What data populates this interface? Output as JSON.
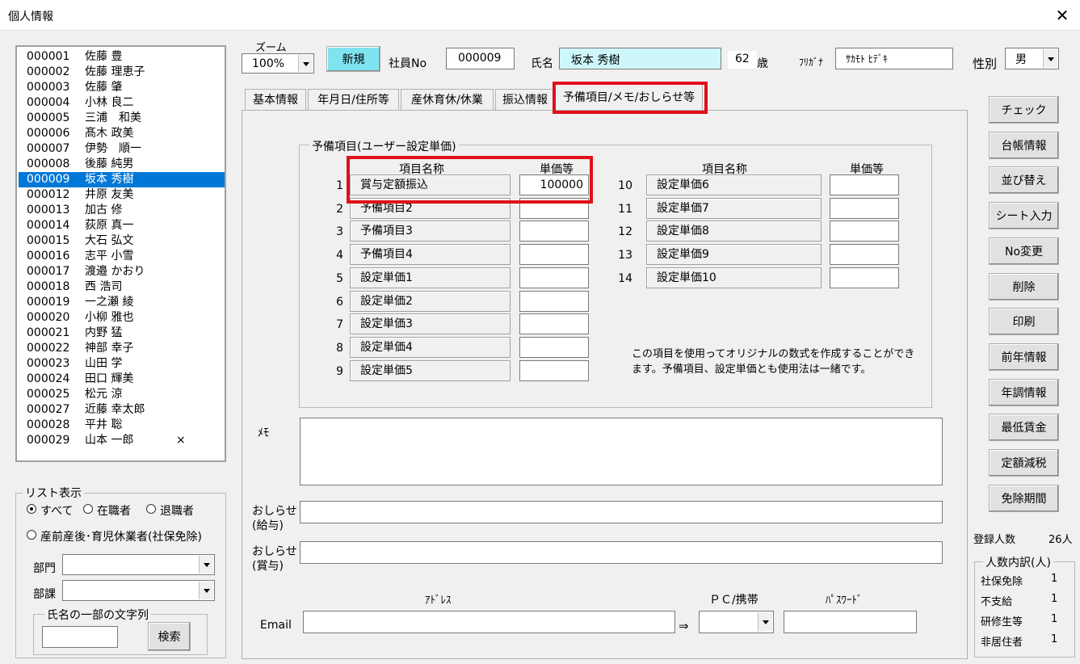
{
  "window": {
    "title": "個人情報",
    "close": "✕"
  },
  "list": {
    "items": [
      {
        "no": "000001",
        "name": "佐藤 豊",
        "mark": ""
      },
      {
        "no": "000002",
        "name": "佐藤 理恵子",
        "mark": ""
      },
      {
        "no": "000003",
        "name": "佐藤 肇",
        "mark": ""
      },
      {
        "no": "000004",
        "name": "小林 良二",
        "mark": ""
      },
      {
        "no": "000005",
        "name": "三浦　和美",
        "mark": ""
      },
      {
        "no": "000006",
        "name": "髙木 政美",
        "mark": ""
      },
      {
        "no": "000007",
        "name": "伊勢　順一",
        "mark": ""
      },
      {
        "no": "000008",
        "name": "後藤 純男",
        "mark": ""
      },
      {
        "no": "000009",
        "name": "坂本 秀樹",
        "mark": ""
      },
      {
        "no": "000012",
        "name": "井原 友美",
        "mark": ""
      },
      {
        "no": "000013",
        "name": "加古 修",
        "mark": ""
      },
      {
        "no": "000014",
        "name": "荻原 真一",
        "mark": ""
      },
      {
        "no": "000015",
        "name": "大石 弘文",
        "mark": ""
      },
      {
        "no": "000016",
        "name": "志平 小雪",
        "mark": ""
      },
      {
        "no": "000017",
        "name": "渡邉 かおり",
        "mark": ""
      },
      {
        "no": "000018",
        "name": "西 浩司",
        "mark": ""
      },
      {
        "no": "000019",
        "name": "一之瀬 綾",
        "mark": ""
      },
      {
        "no": "000020",
        "name": "小柳 雅也",
        "mark": ""
      },
      {
        "no": "000021",
        "name": "内野 猛",
        "mark": ""
      },
      {
        "no": "000022",
        "name": "神部 幸子",
        "mark": ""
      },
      {
        "no": "000023",
        "name": "山田 学",
        "mark": ""
      },
      {
        "no": "000024",
        "name": "田口 輝美",
        "mark": ""
      },
      {
        "no": "000025",
        "name": "松元 涼",
        "mark": ""
      },
      {
        "no": "000027",
        "name": "近藤 幸太郎",
        "mark": ""
      },
      {
        "no": "000028",
        "name": "平井 聡",
        "mark": ""
      },
      {
        "no": "000029",
        "name": "山本 一郎",
        "mark": "×"
      }
    ],
    "selected_index": 8
  },
  "list_display": {
    "group_label": "リスト表示",
    "opt_all": "すべて",
    "opt_employed": "在職者",
    "opt_retired": "退職者",
    "opt_leave": "産前産後･育児休業者(社保免除)",
    "dept_label": "部門",
    "section_label": "部課",
    "name_search_group": "氏名の一部の文字列",
    "search_button": "検索"
  },
  "header": {
    "zoom_label": "ズーム",
    "zoom_value": "100%",
    "new_button": "新規",
    "emp_no_label": "社員No",
    "emp_no": "000009",
    "name_label": "氏名",
    "name": "坂本 秀樹",
    "age": "62",
    "age_unit": "歳",
    "furigana_label": "ﾌﾘｶﾞﾅ",
    "furigana": "ｻｶﾓﾄ ﾋﾃﾞｷ",
    "gender_label": "性別",
    "gender": "男"
  },
  "tabs": [
    "基本情報",
    "年月日/住所等",
    "産休育休/休業",
    "振込情報",
    "予備項目/メモ/おしらせ等"
  ],
  "spare": {
    "group_label": "予備項目(ユーザー設定単価)",
    "col_name": "項目名称",
    "col_price": "単価等",
    "left_rows": [
      {
        "n": "1",
        "name": "賞与定額振込",
        "value": "100000"
      },
      {
        "n": "2",
        "name": "予備項目2",
        "value": ""
      },
      {
        "n": "3",
        "name": "予備項目3",
        "value": ""
      },
      {
        "n": "4",
        "name": "予備項目4",
        "value": ""
      },
      {
        "n": "5",
        "name": "設定単価1",
        "value": ""
      },
      {
        "n": "6",
        "name": "設定単価2",
        "value": ""
      },
      {
        "n": "7",
        "name": "設定単価3",
        "value": ""
      },
      {
        "n": "8",
        "name": "設定単価4",
        "value": ""
      },
      {
        "n": "9",
        "name": "設定単価5",
        "value": ""
      }
    ],
    "right_rows": [
      {
        "n": "10",
        "name": "設定単価6",
        "value": ""
      },
      {
        "n": "11",
        "name": "設定単価7",
        "value": ""
      },
      {
        "n": "12",
        "name": "設定単価8",
        "value": ""
      },
      {
        "n": "13",
        "name": "設定単価9",
        "value": ""
      },
      {
        "n": "14",
        "name": "設定単価10",
        "value": ""
      }
    ],
    "note_line1": "この項目を使用ってオリジナルの数式を作成することができ",
    "note_line2": "ます。予備項目、設定単価とも使用法は一緒です。"
  },
  "memo": {
    "memo_label": "ﾒﾓ",
    "notice_salary_1": "おしらせ",
    "notice_salary_2": "(給与)",
    "notice_bonus_1": "おしらせ",
    "notice_bonus_2": "(賞与)",
    "address_label": "ｱﾄﾞﾚｽ",
    "pc_label": "ＰＣ/携帯",
    "password_label": "ﾊﾟｽﾜｰﾄﾞ",
    "email_label": "Email",
    "arrow": "⇒"
  },
  "side_buttons": [
    "チェック",
    "台帳情報",
    "並び替え",
    "シート入力",
    "No変更",
    "削除",
    "印刷",
    "前年情報",
    "年調情報",
    "最低賃金",
    "定額減税",
    "免除期間"
  ],
  "stats": {
    "registered_label": "登録人数",
    "registered_value": "26人",
    "breakdown_label": "人数内訳(人)",
    "rows": [
      {
        "label": "社保免除",
        "value": "1"
      },
      {
        "label": "不支給",
        "value": "1"
      },
      {
        "label": "研修生等",
        "value": "1"
      },
      {
        "label": "非居住者",
        "value": "1"
      }
    ]
  },
  "colors": {
    "highlight": "#e0101a",
    "selection": "#0078d7",
    "new_button": "#7fe3f0",
    "name_field": "#cef7fb"
  }
}
